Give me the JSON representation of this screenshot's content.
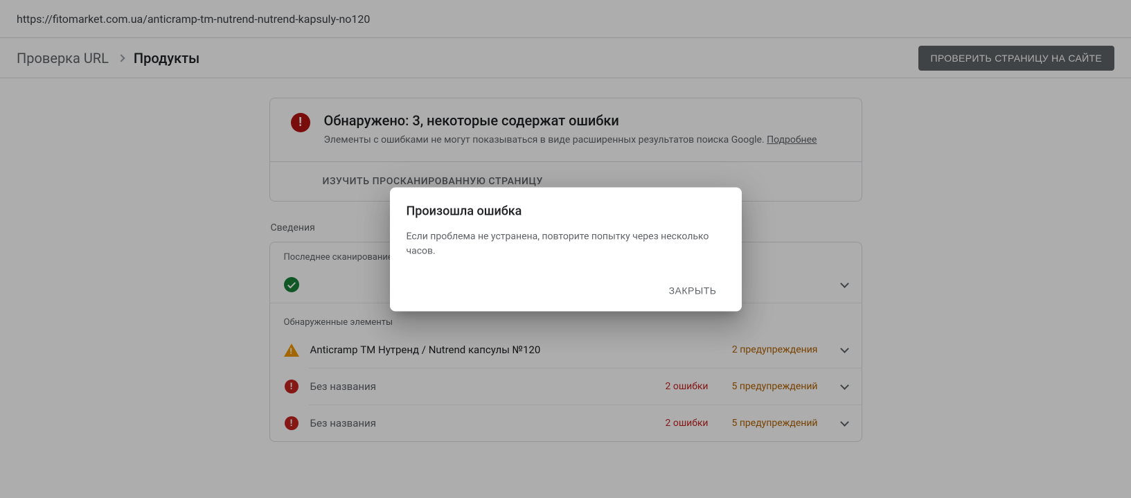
{
  "url": "https://fitomarket.com.ua/anticramp-tm-nutrend-nutrend-kapsuly-no120",
  "breadcrumb": {
    "root": "Проверка URL",
    "current": "Продукты"
  },
  "header": {
    "test_live_button": "ПРОВЕРИТЬ СТРАНИЦУ НА САЙТЕ"
  },
  "summary": {
    "title": "Обнаружено: 3, некоторые содержат ошибки",
    "subtitle_text": "Элементы с ошибками не могут показываться в виде расширенных результатов поиска Google. ",
    "learn_more": "Подробнее",
    "footer_action": "ИЗУЧИТЬ ПРОСКАНИРОВАННУЮ СТРАНИЦУ"
  },
  "details": {
    "section_label": "Сведения",
    "crawl_label": "Последнее сканирование",
    "crawl_value": "",
    "items_label": "Обнаруженные элементы",
    "items": [
      {
        "icon": "warning",
        "title": "Anticramp ТМ Нутренд / Nutrend капсулы №120",
        "errors": "",
        "warnings": "2 предупреждения"
      },
      {
        "icon": "error",
        "title": "Без названия",
        "errors": "2 ошибки",
        "warnings": "5 предупреждений"
      },
      {
        "icon": "error",
        "title": "Без названия",
        "errors": "2 ошибки",
        "warnings": "5 предупреждений"
      }
    ]
  },
  "dialog": {
    "title": "Произошла ошибка",
    "body": "Если проблема не устранена, повторите попытку через несколько часов.",
    "close": "ЗАКРЫТЬ"
  }
}
